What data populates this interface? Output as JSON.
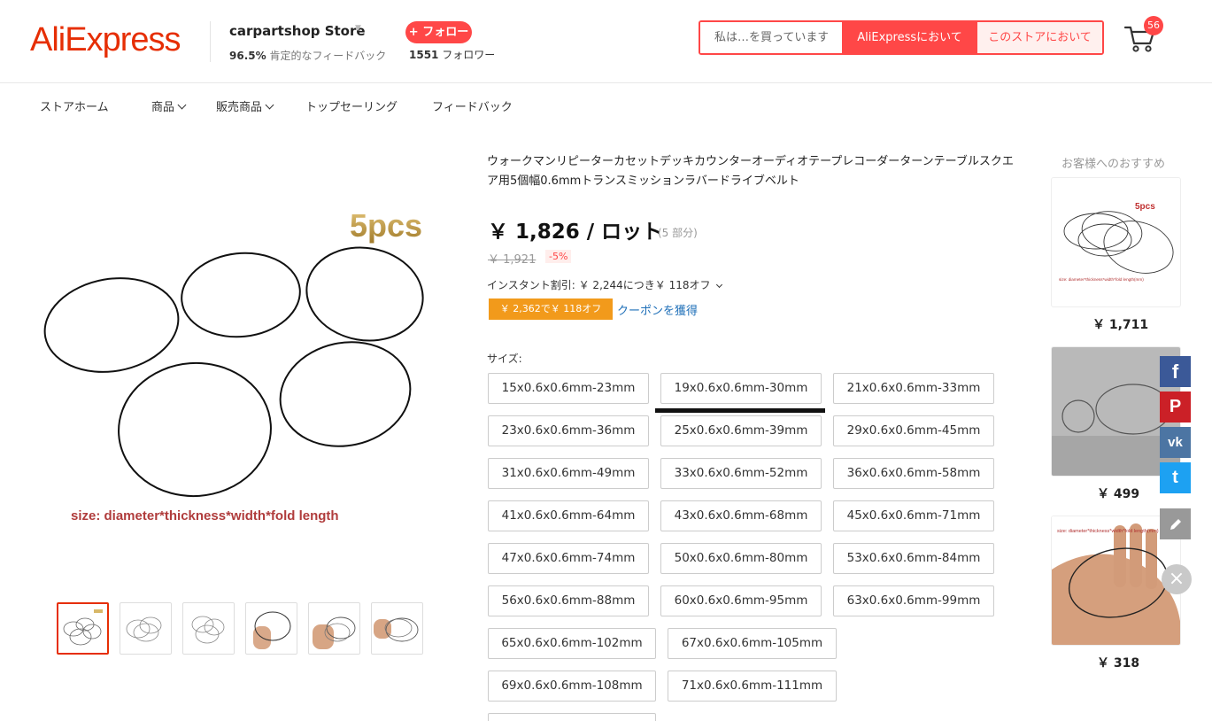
{
  "header": {
    "logo": "AliExpress",
    "store_name": "carpartshop Store",
    "feedback_pct": "96.5%",
    "feedback_label": "肯定的なフィードバック",
    "follow_label": "+ フォロー",
    "followers_count": "1551",
    "followers_label": "フォロワー",
    "search_placeholder": "私は…を買っています",
    "search_all_label": "AliExpressにおいて",
    "search_store_label": "このストアにおいて",
    "cart_count": "56"
  },
  "nav": {
    "items": [
      {
        "label": "ストアホーム"
      },
      {
        "label": "商品"
      },
      {
        "label": "販売商品"
      },
      {
        "label": "トップセーリング"
      },
      {
        "label": "フィードバック"
      }
    ]
  },
  "gallery": {
    "badge_text": "5pcs",
    "caption": "size: diameter*thickness*width*fold length"
  },
  "product": {
    "title": "ウォークマンリピーターカセットデッキカウンターオーディオテープレコーダーターンテーブルスクエア用5個幅0.6mmトランスミッションラバードライブベルト",
    "price": "￥ 1,826 / ロット",
    "units": "(5 部分)",
    "original_price": "￥ 1,921",
    "discount": "-5%",
    "instant_discount": "インスタント割引: ￥ 2,244につき￥ 118オフ",
    "coupon_badge": "￥ 2,362で￥ 118オフ",
    "coupon_link": "クーポンを獲得",
    "size_label": "サイズ:",
    "sizes": [
      "15x0.6x0.6mm-23mm",
      "19x0.6x0.6mm-30mm",
      "21x0.6x0.6mm-33mm",
      "23x0.6x0.6mm-36mm",
      "25x0.6x0.6mm-39mm",
      "29x0.6x0.6mm-45mm",
      "31x0.6x0.6mm-49mm",
      "33x0.6x0.6mm-52mm",
      "36x0.6x0.6mm-58mm",
      "41x0.6x0.6mm-64mm",
      "43x0.6x0.6mm-68mm",
      "45x0.6x0.6mm-71mm",
      "47x0.6x0.6mm-74mm",
      "50x0.6x0.6mm-80mm",
      "53x0.6x0.6mm-84mm",
      "56x0.6x0.6mm-88mm",
      "60x0.6x0.6mm-95mm",
      "63x0.6x0.6mm-99mm",
      "65x0.6x0.6mm-102mm",
      "67x0.6x0.6mm-105mm",
      "69x0.6x0.6mm-108mm",
      "71x0.6x0.6mm-111mm"
    ]
  },
  "recommendations": {
    "title": "お客様へのおすすめ",
    "items": [
      {
        "price": "￥ 1,711",
        "badge": "5pcs",
        "caption": "size: diameter*thickness*width*fold length(mm)"
      },
      {
        "price": "￥ 499"
      },
      {
        "price": "￥ 318",
        "caption": "size: diameter*thickness*width*fold length(mm)"
      }
    ]
  },
  "share": {
    "facebook": "f",
    "pinterest": "P",
    "vk": "vk",
    "twitter": "t",
    "close": "×"
  },
  "colors": {
    "brand": "#e62e04",
    "accent": "#ff4747",
    "coupon": "#f29a1b",
    "link": "#1e6fb8",
    "facebook": "#3b5998",
    "pinterest": "#cb2027",
    "vk": "#4c75a3",
    "twitter": "#1da1f2"
  }
}
